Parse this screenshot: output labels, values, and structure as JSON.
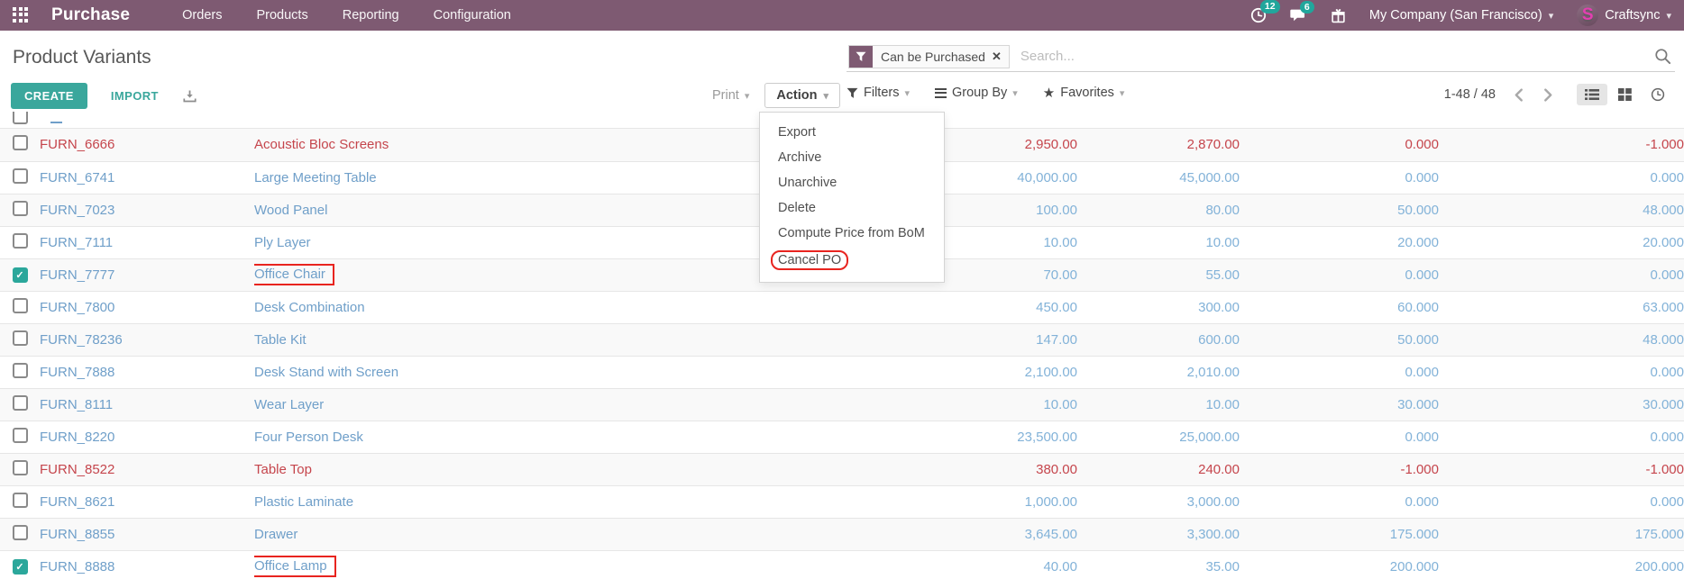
{
  "colors": {
    "navbar_bg": "#7e5a72",
    "accent_teal": "#3aa79c",
    "badge_teal": "#21a69c",
    "link_blue": "#6f9fc9",
    "value_blue": "#82b2d8",
    "danger_red": "#c5454c",
    "annotation_red": "#e8241f"
  },
  "icons": {
    "caret": "▾",
    "close": "✕",
    "star": "★",
    "check": "✓"
  },
  "navbar": {
    "app_name": "Purchase",
    "menu_items": [
      "Orders",
      "Products",
      "Reporting",
      "Configuration"
    ],
    "activity_badge": "12",
    "message_badge": "6",
    "company_name": "My Company (San Francisco)",
    "user_name": "Craftsync",
    "avatar_letter": "S"
  },
  "page": {
    "title": "Product Variants"
  },
  "search": {
    "filter_tag": "Can be Purchased",
    "placeholder": "Search..."
  },
  "toolbar": {
    "create": "CREATE",
    "import": "IMPORT",
    "print": "Print",
    "action": "Action",
    "filters": "Filters",
    "group_by": "Group By",
    "favorites": "Favorites",
    "pager": "1-48 / 48"
  },
  "action_menu": {
    "items": [
      "Export",
      "Archive",
      "Unarchive",
      "Delete",
      "Compute Price from BoM",
      "Cancel PO"
    ],
    "highlighted_item": "Cancel PO"
  },
  "table": {
    "rows": [
      {
        "code": "FURN_6666",
        "name": "Acoustic Bloc Screens",
        "n1": "2,950.00",
        "n2": "2,870.00",
        "n3": "0.000",
        "n4": "-1.000",
        "danger": true,
        "checked": false,
        "annotated": false
      },
      {
        "code": "FURN_6741",
        "name": "Large Meeting Table",
        "n1": "40,000.00",
        "n2": "45,000.00",
        "n3": "0.000",
        "n4": "0.000",
        "danger": false,
        "checked": false,
        "annotated": false
      },
      {
        "code": "FURN_7023",
        "name": "Wood Panel",
        "n1": "100.00",
        "n2": "80.00",
        "n3": "50.000",
        "n4": "48.000",
        "danger": false,
        "checked": false,
        "annotated": false
      },
      {
        "code": "FURN_7111",
        "name": "Ply Layer",
        "n1": "10.00",
        "n2": "10.00",
        "n3": "20.000",
        "n4": "20.000",
        "danger": false,
        "checked": false,
        "annotated": false
      },
      {
        "code": "FURN_7777",
        "name": "Office Chair",
        "n1": "70.00",
        "n2": "55.00",
        "n3": "0.000",
        "n4": "0.000",
        "danger": false,
        "checked": true,
        "annotated": true
      },
      {
        "code": "FURN_7800",
        "name": "Desk Combination",
        "n1": "450.00",
        "n2": "300.00",
        "n3": "60.000",
        "n4": "63.000",
        "danger": false,
        "checked": false,
        "annotated": false
      },
      {
        "code": "FURN_78236",
        "name": "Table Kit",
        "n1": "147.00",
        "n2": "600.00",
        "n3": "50.000",
        "n4": "48.000",
        "danger": false,
        "checked": false,
        "annotated": false
      },
      {
        "code": "FURN_7888",
        "name": "Desk Stand with Screen",
        "n1": "2,100.00",
        "n2": "2,010.00",
        "n3": "0.000",
        "n4": "0.000",
        "danger": false,
        "checked": false,
        "annotated": false
      },
      {
        "code": "FURN_8111",
        "name": "Wear Layer",
        "n1": "10.00",
        "n2": "10.00",
        "n3": "30.000",
        "n4": "30.000",
        "danger": false,
        "checked": false,
        "annotated": false
      },
      {
        "code": "FURN_8220",
        "name": "Four Person Desk",
        "n1": "23,500.00",
        "n2": "25,000.00",
        "n3": "0.000",
        "n4": "0.000",
        "danger": false,
        "checked": false,
        "annotated": false
      },
      {
        "code": "FURN_8522",
        "name": "Table Top",
        "n1": "380.00",
        "n2": "240.00",
        "n3": "-1.000",
        "n4": "-1.000",
        "danger": true,
        "checked": false,
        "annotated": false
      },
      {
        "code": "FURN_8621",
        "name": "Plastic Laminate",
        "n1": "1,000.00",
        "n2": "3,000.00",
        "n3": "0.000",
        "n4": "0.000",
        "danger": false,
        "checked": false,
        "annotated": false
      },
      {
        "code": "FURN_8855",
        "name": "Drawer",
        "n1": "3,645.00",
        "n2": "3,300.00",
        "n3": "175.000",
        "n4": "175.000",
        "danger": false,
        "checked": false,
        "annotated": false
      },
      {
        "code": "FURN_8888",
        "name": "Office Lamp",
        "n1": "40.00",
        "n2": "35.00",
        "n3": "200.000",
        "n4": "200.000",
        "danger": false,
        "checked": true,
        "annotated": true
      }
    ]
  }
}
